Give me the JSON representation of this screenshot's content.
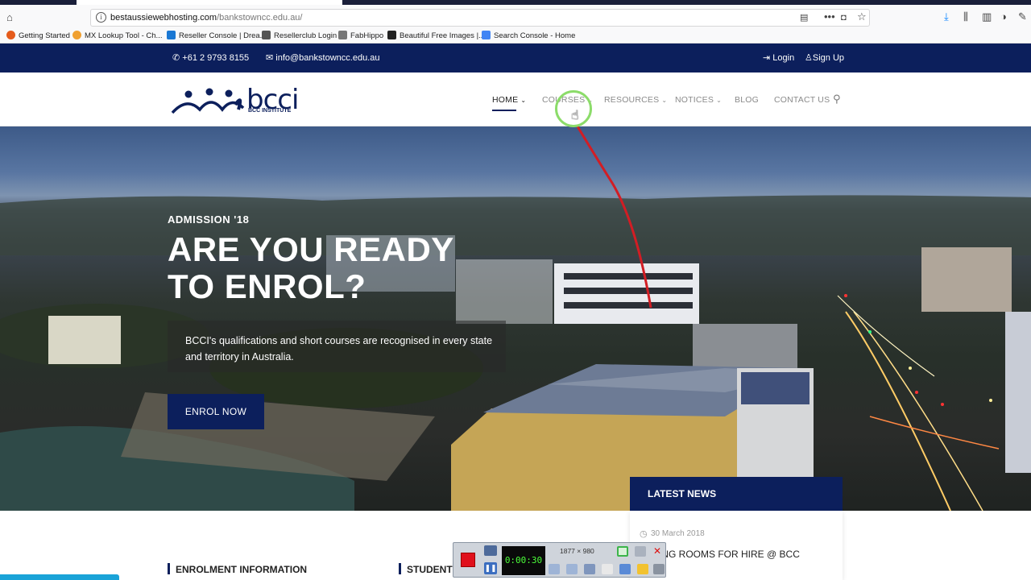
{
  "browser": {
    "url_domain": "bestaussiewebhosting.com",
    "url_path": "/bankstowncc.edu.au/",
    "bookmarks": [
      {
        "label": "Getting Started",
        "color": "#e55b1b"
      },
      {
        "label": "MX Lookup Tool - Ch...",
        "color": "#f0a030"
      },
      {
        "label": "Reseller Console | Drea...",
        "color": "#1a78d4"
      },
      {
        "label": "Resellerclub Login",
        "color": "#555555"
      },
      {
        "label": "FabHippo",
        "color": "#666666"
      },
      {
        "label": "Beautiful Free Images |...",
        "color": "#222222"
      },
      {
        "label": "Search Console - Home",
        "color": "#4285f4"
      }
    ]
  },
  "topbar": {
    "phone": "+61 2 9793 8155",
    "email": "info@bankstowncc.edu.au",
    "login": "Login",
    "signup": "Sign Up"
  },
  "brand": {
    "logo_text": "bcci",
    "logo_subtext": "BCC INSTITUTE",
    "color": "#0c1f5c"
  },
  "nav": {
    "items": [
      {
        "label": "HOME",
        "dropdown": true,
        "active": true
      },
      {
        "label": "COURSES",
        "dropdown": true,
        "active": false
      },
      {
        "label": "RESOURCES",
        "dropdown": true,
        "active": false
      },
      {
        "label": "NOTICES",
        "dropdown": true,
        "active": false
      },
      {
        "label": "BLOG",
        "dropdown": false,
        "active": false
      },
      {
        "label": "CONTACT US",
        "dropdown": false,
        "active": false
      }
    ]
  },
  "hero": {
    "admission": "ADMISSION '18",
    "headline_line1": "ARE YOU READY",
    "headline_line2": "TO ENROL?",
    "subtext": "BCCI's qualifications and short courses are recognised in every state and territory in Australia.",
    "cta": "ENROL NOW"
  },
  "news": {
    "heading": "LATEST NEWS",
    "date": "30 March 2018",
    "title": "AINING ROOMS FOR HIRE @ BCC"
  },
  "sections": {
    "enrolment": "ENROLMENT INFORMATION",
    "student": "STUDENT"
  },
  "recorder": {
    "timer": "0:00:30",
    "size": "1877 × 980"
  }
}
